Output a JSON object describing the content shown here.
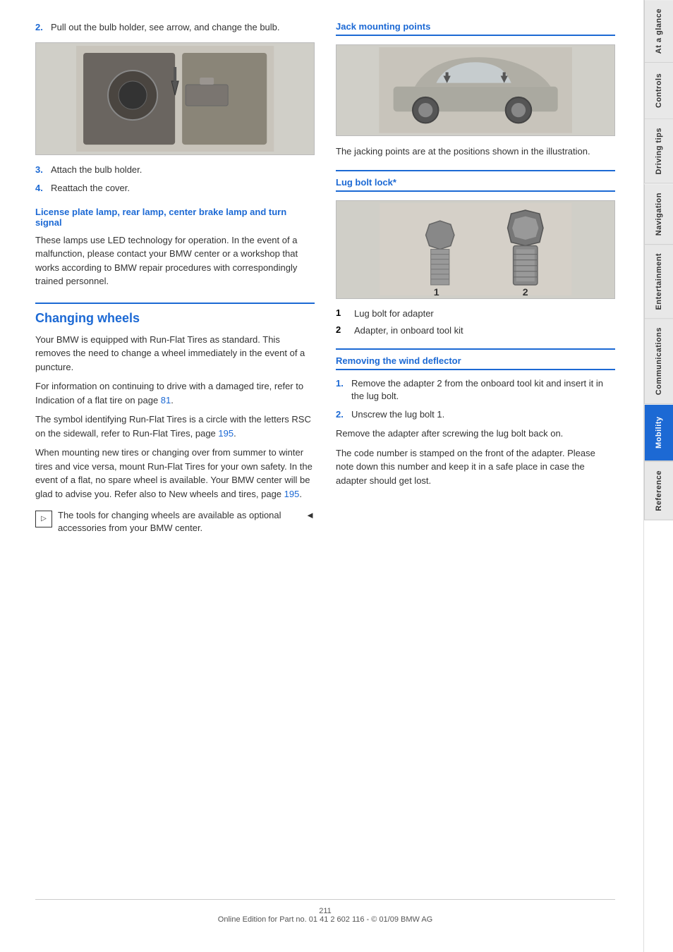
{
  "sidebar": {
    "tabs": [
      {
        "label": "At a glance",
        "active": false
      },
      {
        "label": "Controls",
        "active": false
      },
      {
        "label": "Driving tips",
        "active": false
      },
      {
        "label": "Navigation",
        "active": false
      },
      {
        "label": "Entertainment",
        "active": false
      },
      {
        "label": "Communications",
        "active": false
      },
      {
        "label": "Mobility",
        "active": true
      },
      {
        "label": "Reference",
        "active": false
      }
    ]
  },
  "left_col": {
    "step2_text": "Pull out the bulb holder, see arrow, and change the bulb.",
    "step3_text": "Attach the bulb holder.",
    "step4_text": "Reattach the cover.",
    "license_heading": "License plate lamp, rear lamp, center brake lamp and turn signal",
    "license_text": "These lamps use LED technology for operation. In the event of a malfunction, please contact your BMW center or a workshop that works according to BMW repair procedures with correspondingly trained personnel.",
    "changing_wheels_heading": "Changing wheels",
    "para1": "Your BMW is equipped with Run-Flat Tires as standard. This removes the need to change a wheel immediately in the event of a puncture.",
    "para2": "For information on continuing to drive with a damaged tire, refer to Indication of a flat tire on page 81.",
    "para3": "The symbol identifying Run-Flat Tires is a circle with the letters RSC on the sidewall, refer to Run-Flat Tires, page 195.",
    "para4": "When mounting new tires or changing over from summer to winter tires and vice versa, mount Run-Flat Tires for your own safety. In the event of a flat, no spare wheel is available. Your BMW center will be glad to advise you. Refer also to New wheels and tires, page 195.",
    "note_text": "The tools for changing wheels are available as optional accessories from your BMW center.",
    "note_end": "◄",
    "link_81": "81",
    "link_195a": "195",
    "link_195b": "195"
  },
  "right_col": {
    "jack_heading": "Jack mounting points",
    "jack_desc": "The jacking points are at the positions shown in the illustration.",
    "lug_heading": "Lug bolt lock*",
    "lug_items": [
      {
        "num": "1",
        "text": "Lug bolt for adapter"
      },
      {
        "num": "2",
        "text": "Adapter, in onboard tool kit"
      }
    ],
    "wind_heading": "Removing the wind deflector",
    "wind_step1": "Remove the adapter 2 from the onboard tool kit and insert it in the lug bolt.",
    "wind_step2": "Unscrew the lug bolt 1.",
    "wind_para1": "Remove the adapter after screwing the lug bolt back on.",
    "wind_para2": "The code number is stamped on the front of the adapter. Please note down this number and keep it in a safe place in case the adapter should get lost."
  },
  "footer": {
    "page_num": "211",
    "online_edition": "Online Edition for Part no. 01 41 2 602 116 - © 01/09 BMW AG"
  }
}
